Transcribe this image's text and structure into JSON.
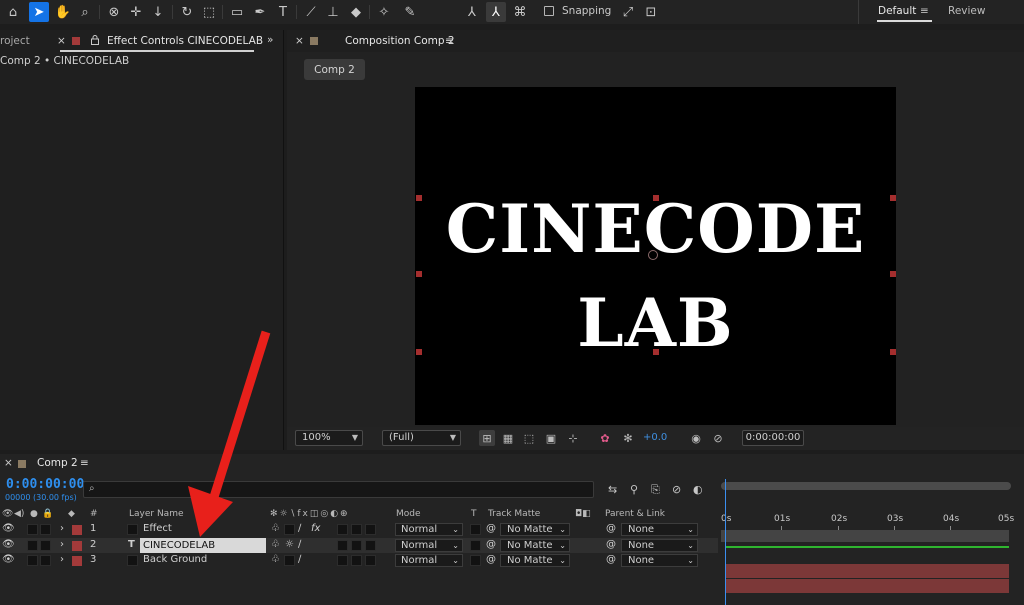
{
  "toolbar": {
    "snapping_label": "Snapping",
    "workspaces": [
      "Default",
      "Review"
    ]
  },
  "left_panel": {
    "project_tab": "roject",
    "effect_tab": "Effect Controls CINECODELAB",
    "subtitle": "Comp 2 • CINECODELAB"
  },
  "comp_panel": {
    "tab": "Composition Comp 2",
    "chip": "Comp 2",
    "viewer_line1": "CINECODE",
    "viewer_line2": "LAB"
  },
  "viewer_bar": {
    "zoom": "100%",
    "resolution": "(Full)",
    "exposure": "+0.0",
    "timecode": "0:00:00:00"
  },
  "timeline": {
    "tab": "Comp 2",
    "timecode": "0:00:00:00",
    "fps": "00000 (30.00 fps)",
    "search_icon": "search-icon",
    "headers": {
      "number": "#",
      "layer_name": "Layer Name",
      "mode": "Mode",
      "t": "T",
      "track_matte": "Track Matte",
      "parent": "Parent & Link"
    },
    "layers": [
      {
        "num": "1",
        "name": "Effect",
        "mode": "Normal",
        "matte": "No Matte",
        "parent": "None"
      },
      {
        "num": "2",
        "name": "CINECODELAB",
        "mode": "Normal",
        "matte": "No Matte",
        "parent": "None"
      },
      {
        "num": "3",
        "name": "Back Ground",
        "mode": "Normal",
        "matte": "No Matte",
        "parent": "None"
      }
    ],
    "ruler_ticks": [
      "0s",
      "01s",
      "02s",
      "03s",
      "04s",
      "05s"
    ]
  },
  "colors": {
    "accent": "#1473e6",
    "timecode": "#2e8fef",
    "layer_label": "#a33a3a",
    "track_bar": "#7c3838",
    "arrow": "#e8201b"
  }
}
